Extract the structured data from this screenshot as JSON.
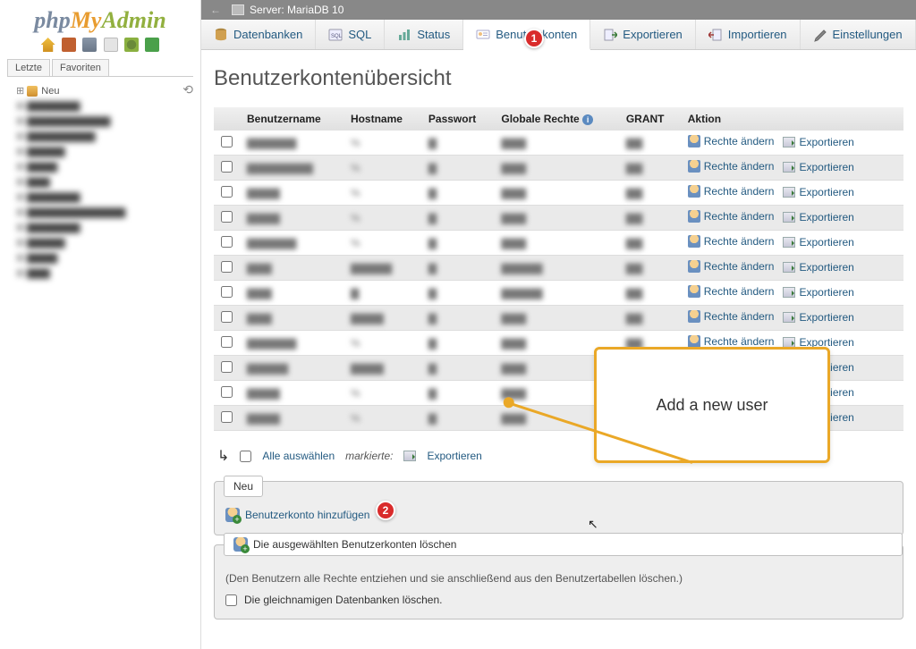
{
  "sidebar": {
    "logo": "phpMyAdmin",
    "tabs": [
      "Letzte",
      "Favoriten"
    ],
    "neu": "Neu",
    "tree": [
      "▇▇▇▇▇▇▇",
      "▇▇▇▇▇▇▇▇▇▇▇",
      "▇▇▇▇▇▇▇▇▇",
      "▇▇▇▇▇",
      "▇▇▇▇",
      "▇▇▇",
      "▇▇▇▇▇▇▇",
      "▇▇▇▇▇▇▇▇▇▇▇▇▇",
      "▇▇▇▇▇▇▇",
      "▇▇▇▇▇",
      "▇▇▇▇",
      "▇▇▇"
    ]
  },
  "topbar": {
    "server_label": "Server: MariaDB 10"
  },
  "tabs": {
    "databases": "Datenbanken",
    "sql": "SQL",
    "status": "Status",
    "users": "Benutzerkonten",
    "export": "Exportieren",
    "import": "Importieren",
    "settings": "Einstellungen"
  },
  "page": {
    "title": "Benutzerkontenübersicht"
  },
  "table": {
    "headers": {
      "user": "Benutzername",
      "host": "Hostname",
      "pass": "Passwort",
      "global": "Globale Rechte",
      "grant": "GRANT",
      "action": "Aktion"
    },
    "action": {
      "edit": "Rechte ändern",
      "export": "Exportieren"
    },
    "rows": [
      {
        "u": "▇▇▇▇▇▇",
        "h": "%",
        "p": "▇",
        "g": "▇▇▇",
        "gr": "▇▇"
      },
      {
        "u": "▇▇▇▇▇▇▇▇",
        "h": "%",
        "p": "▇",
        "g": "▇▇▇",
        "gr": "▇▇"
      },
      {
        "u": "▇▇▇▇",
        "h": "%",
        "p": "▇",
        "g": "▇▇▇",
        "gr": "▇▇"
      },
      {
        "u": "▇▇▇▇",
        "h": "%",
        "p": "▇",
        "g": "▇▇▇",
        "gr": "▇▇"
      },
      {
        "u": "▇▇▇▇▇▇",
        "h": "%",
        "p": "▇",
        "g": "▇▇▇",
        "gr": "▇▇"
      },
      {
        "u": "▇▇▇",
        "h": "▇▇▇▇▇",
        "p": "▇",
        "g": "▇▇▇▇▇",
        "gr": "▇▇"
      },
      {
        "u": "▇▇▇",
        "h": "▇",
        "p": "▇",
        "g": "▇▇▇▇▇",
        "gr": "▇▇"
      },
      {
        "u": "▇▇▇",
        "h": "▇▇▇▇",
        "p": "▇",
        "g": "▇▇▇",
        "gr": "▇▇"
      },
      {
        "u": "▇▇▇▇▇▇",
        "h": "%",
        "p": "▇",
        "g": "▇▇▇",
        "gr": "▇▇"
      },
      {
        "u": "▇▇▇▇▇",
        "h": "▇▇▇▇",
        "p": "▇",
        "g": "▇▇▇",
        "gr": "▇▇"
      },
      {
        "u": "▇▇▇▇",
        "h": "%",
        "p": "▇",
        "g": "▇▇▇",
        "gr": "▇▇"
      },
      {
        "u": "▇▇▇▇",
        "h": "%",
        "p": "▇",
        "g": "▇▇▇",
        "gr": "▇▇"
      }
    ]
  },
  "bulk": {
    "select_all": "Alle auswählen",
    "marked": "markierte:",
    "export": "Exportieren"
  },
  "new_fs": {
    "legend": "Neu",
    "add_user": "Benutzerkonto hinzufügen"
  },
  "delete_fs": {
    "legend": "Die ausgewählten Benutzerkonten löschen",
    "note": "(Den Benutzern alle Rechte entziehen und sie anschließend aus den Benutzertabellen löschen.)",
    "checkbox": "Die gleichnamigen Datenbanken löschen."
  },
  "callout": {
    "text": "Add a new user"
  },
  "badges": {
    "one": "1",
    "two": "2"
  }
}
